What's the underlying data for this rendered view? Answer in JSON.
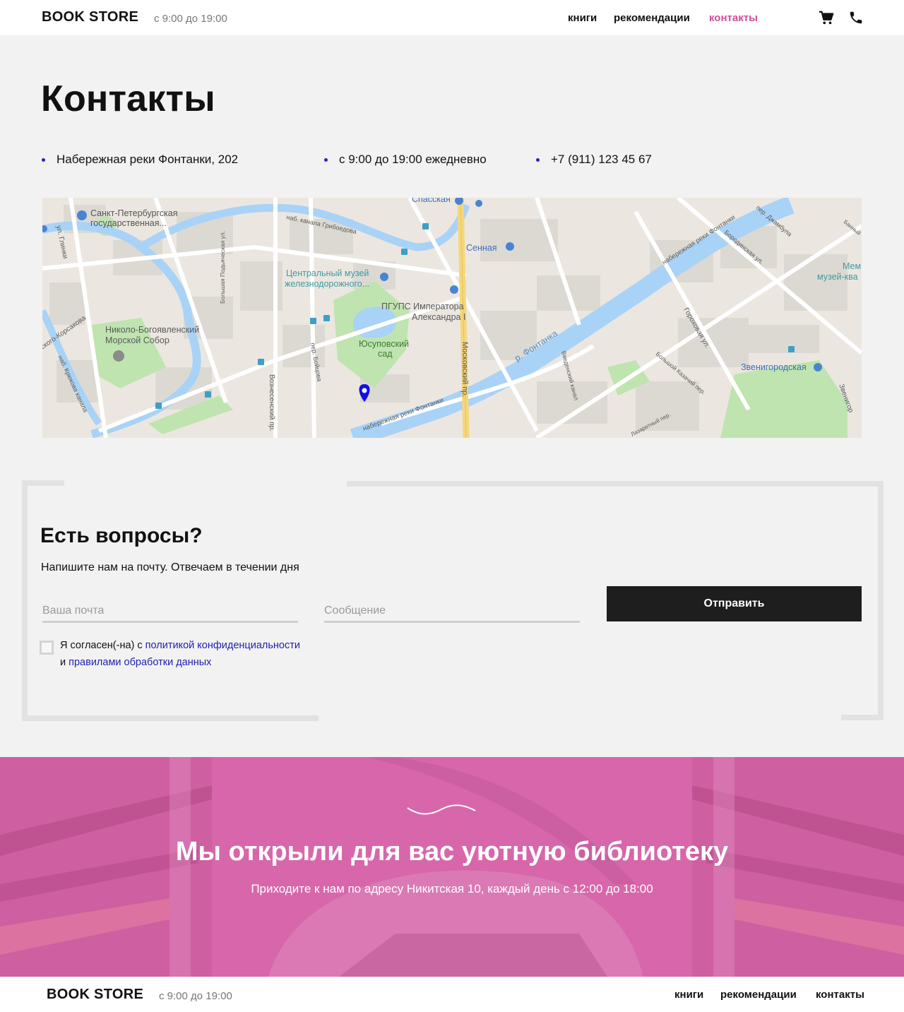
{
  "header": {
    "logo": "BOOK STORE",
    "hours": "с 9:00 до 19:00",
    "nav": [
      {
        "label": "книги"
      },
      {
        "label": "рекомендации"
      },
      {
        "label": "контакты"
      }
    ],
    "icons": [
      "cart-icon",
      "phone-icon"
    ],
    "active_color": "#d04e9b"
  },
  "contacts": {
    "title": "Контакты",
    "items": [
      "Набережная реки Фонтанки, 202",
      "с 9:00 до 19:00 ежедневно",
      "+7 (911) 123 45 67"
    ],
    "bullet_color": "#2323c8"
  },
  "map": {
    "labels": {
      "spasskaya": "Спасская",
      "university": "Санкт-Петербургская",
      "university2": "государственная...",
      "griboedov": "наб. канала Грибоедова",
      "glinki": "ул. Глинки",
      "sennaya": "Сенная",
      "museum1": "Центральный музей",
      "museum2": "железнодорожного...",
      "pgups1": "ПГУПС Императора",
      "pgups2": "Александра I",
      "sobor1": "Николо-Богоявленский",
      "sobor2": "Морской Собор",
      "korsakova": "ского-Корсакова",
      "kryukov": "наб. Крюкова канала",
      "park1": "Юсуповский",
      "park2": "сад",
      "voznesensky": "Вознесенский пр.",
      "podyacheskaya": "Большая Подьяческая ул.",
      "boitsova": "пер. Бойцова",
      "moskovsky": "Московский пр.",
      "fontanka_river": "р. Фонтанка",
      "fontanka_emb": "набережная реки Фонтанки",
      "fontanka_emb2": "набережная реки Фонтанки",
      "dzhambula": "пер. Джамбула",
      "borodinskaya": "Бородинская ул.",
      "gorokhovaya": "Гороховая ул.",
      "kazachiy": "Большой Казачий пер.",
      "vvedensky": "Введенский канал",
      "zvenigorodskaya": "Звенигородская",
      "zvenigorod_st": "Звенигор",
      "lazaretny": "Лазаретный пер.",
      "museum_r1": "Мем",
      "museum_r2": "музей-ква",
      "banny": "Банный"
    },
    "pin_color": "#1010e6"
  },
  "form": {
    "title": "Есть вопросы?",
    "subtitle": "Напишите нам на почту. Отвечаем в течении дня",
    "email_placeholder": "Ваша почта",
    "message_placeholder": "Сообщение",
    "submit_label": "Отправить",
    "consent_pre": "Я согласен(-на) с ",
    "consent_link1": "политикой конфиденциальности",
    "consent_mid": "и ",
    "consent_link2": "правилами обработки данных",
    "link_color": "#1f1fb0"
  },
  "banner": {
    "title": "Мы открыли для вас уютную библиотеку",
    "subtitle": "Приходите к нам по адресу Никитская 10, каждый день с 12:00 до 18:00",
    "overlay_color": "#d565a8"
  },
  "footer": {
    "logo": "BOOK STORE",
    "hours": "с 9:00 до 19:00",
    "nav": [
      {
        "label": "книги"
      },
      {
        "label": "рекомендации"
      },
      {
        "label": "контакты"
      }
    ]
  }
}
